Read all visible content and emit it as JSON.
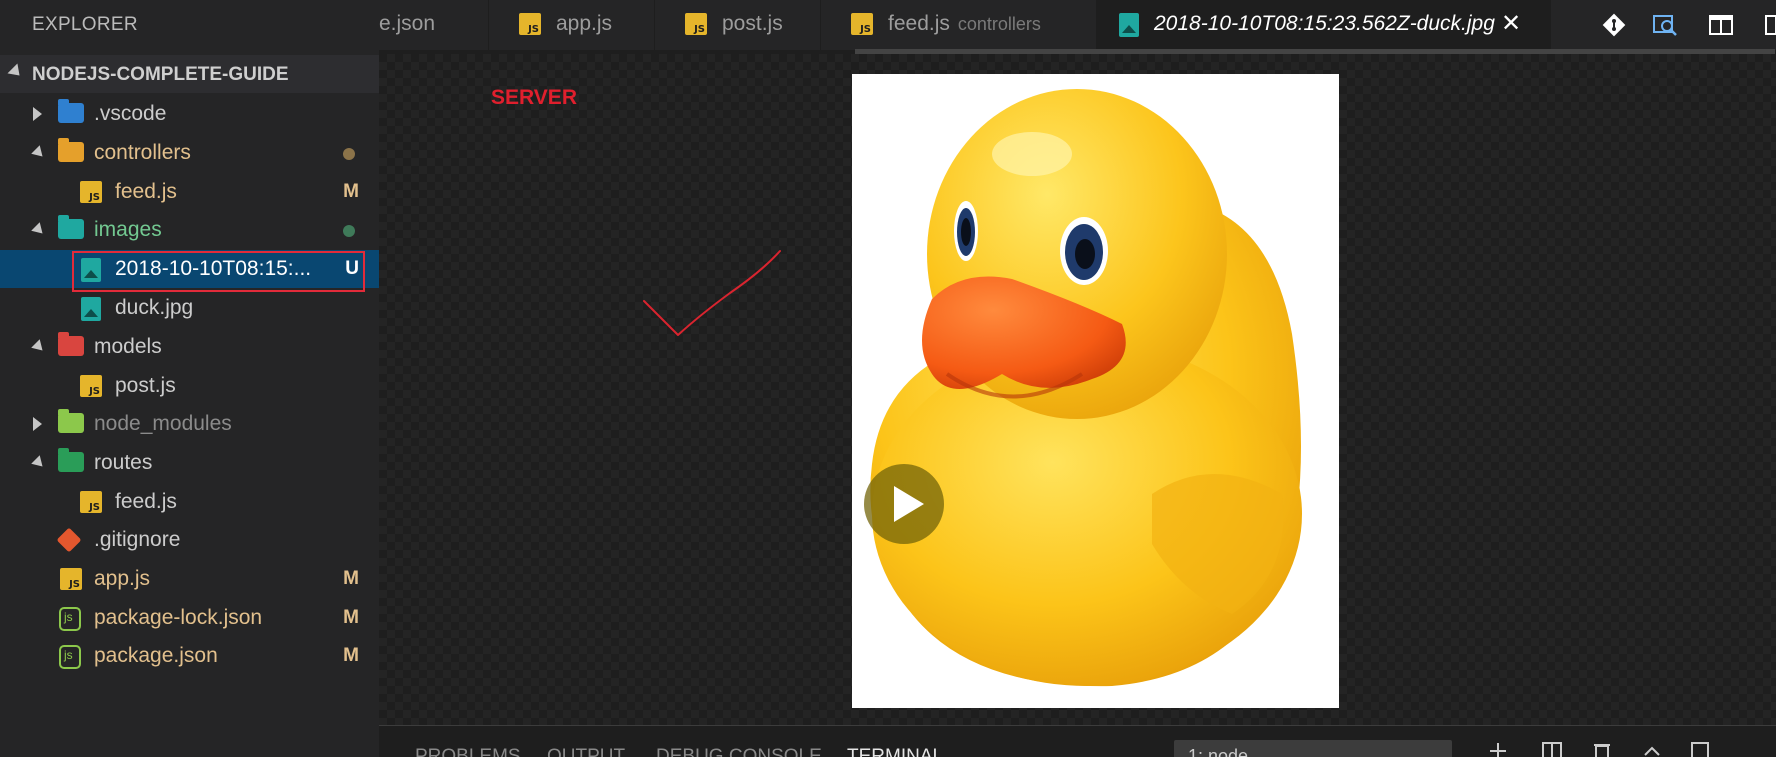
{
  "sidebar": {
    "title": "EXPLORER",
    "project": "NODEJS-COMPLETE-GUIDE",
    "items": [
      {
        "label": ".vscode",
        "badge": ""
      },
      {
        "label": "controllers",
        "badge": ""
      },
      {
        "label": "feed.js",
        "badge": "M"
      },
      {
        "label": "images",
        "badge": ""
      },
      {
        "label": "2018-10-10T08:15:...",
        "badge": "U"
      },
      {
        "label": "duck.jpg",
        "badge": ""
      },
      {
        "label": "models",
        "badge": ""
      },
      {
        "label": "post.js",
        "badge": ""
      },
      {
        "label": "node_modules",
        "badge": ""
      },
      {
        "label": "routes",
        "badge": ""
      },
      {
        "label": "feed.js",
        "badge": ""
      },
      {
        "label": ".gitignore",
        "badge": ""
      },
      {
        "label": "app.js",
        "badge": "M"
      },
      {
        "label": "package-lock.json",
        "badge": "M"
      },
      {
        "label": "package.json",
        "badge": "M"
      }
    ]
  },
  "tabs": [
    {
      "label": "e.json",
      "desc": ""
    },
    {
      "label": "app.js",
      "desc": ""
    },
    {
      "label": "post.js",
      "desc": ""
    },
    {
      "label": "feed.js",
      "desc": "controllers"
    },
    {
      "label": "2018-10-10T08:15:23.562Z-duck.jpg",
      "desc": "",
      "close": "✕"
    }
  ],
  "editor": {
    "annotation": "SERVER"
  },
  "panel": {
    "tabs": [
      "PROBLEMS",
      "OUTPUT",
      "DEBUG CONSOLE",
      "TERMINAL"
    ],
    "terminal_select": "1: node"
  },
  "colors": {
    "accent_selection": "#094771",
    "highlight_box": "#e22b3a",
    "modified": "#e2c08d",
    "untracked": "#73c991",
    "js_yellow": "#e5b52b",
    "image_teal": "#1fa8a0"
  },
  "icons": {
    "vscode_folder": "vscode-folder-icon",
    "controllers_folder": "controllers-folder-icon",
    "images_folder": "images-folder-icon",
    "models_folder": "models-folder-icon",
    "node_modules_folder": "node-modules-folder-icon",
    "routes_folder": "routes-folder-icon",
    "js_file": "js-file-icon",
    "image_file": "image-file-icon",
    "git_file": "git-file-icon",
    "json_file": "nodejs-json-icon"
  }
}
